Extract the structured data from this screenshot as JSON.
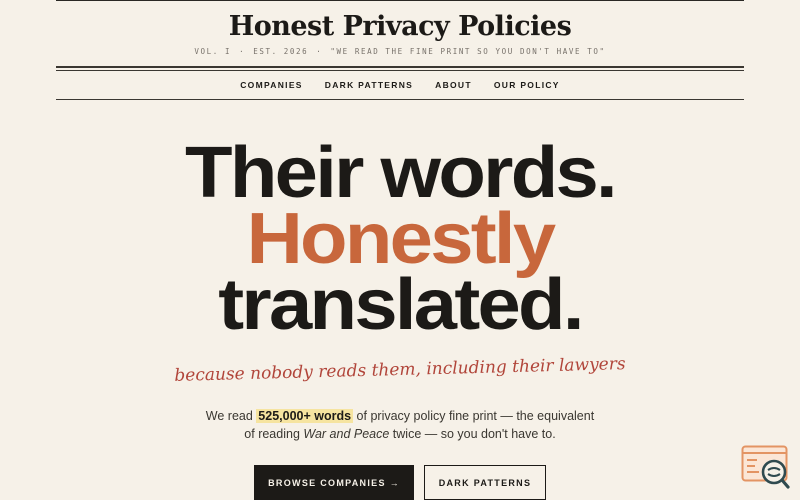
{
  "site": {
    "title": "Honest Privacy Policies",
    "volume": "VOL. I",
    "established": "EST. 2026",
    "motto": "\"WE READ THE FINE PRINT SO YOU DON'T HAVE TO\""
  },
  "nav": {
    "items": [
      {
        "label": "COMPANIES"
      },
      {
        "label": "DARK PATTERNS"
      },
      {
        "label": "ABOUT"
      },
      {
        "label": "OUR POLICY"
      }
    ]
  },
  "hero": {
    "line1": "Their words.",
    "line2": "Honestly",
    "line3": "translated.",
    "accent_color": "#c8673c"
  },
  "script_note": "because nobody reads them, including their lawyers",
  "intro": {
    "before": "We read ",
    "highlight": "525,000+ words",
    "mid1": " of privacy policy fine print — the equivalent",
    "mid2": "of reading ",
    "book": "War and Peace",
    "after": " twice — so you don't have to."
  },
  "cta": {
    "primary": "BROWSE COMPANIES →",
    "secondary": "DARK PATTERNS"
  },
  "widget": {
    "icon": "search-document-icon"
  }
}
